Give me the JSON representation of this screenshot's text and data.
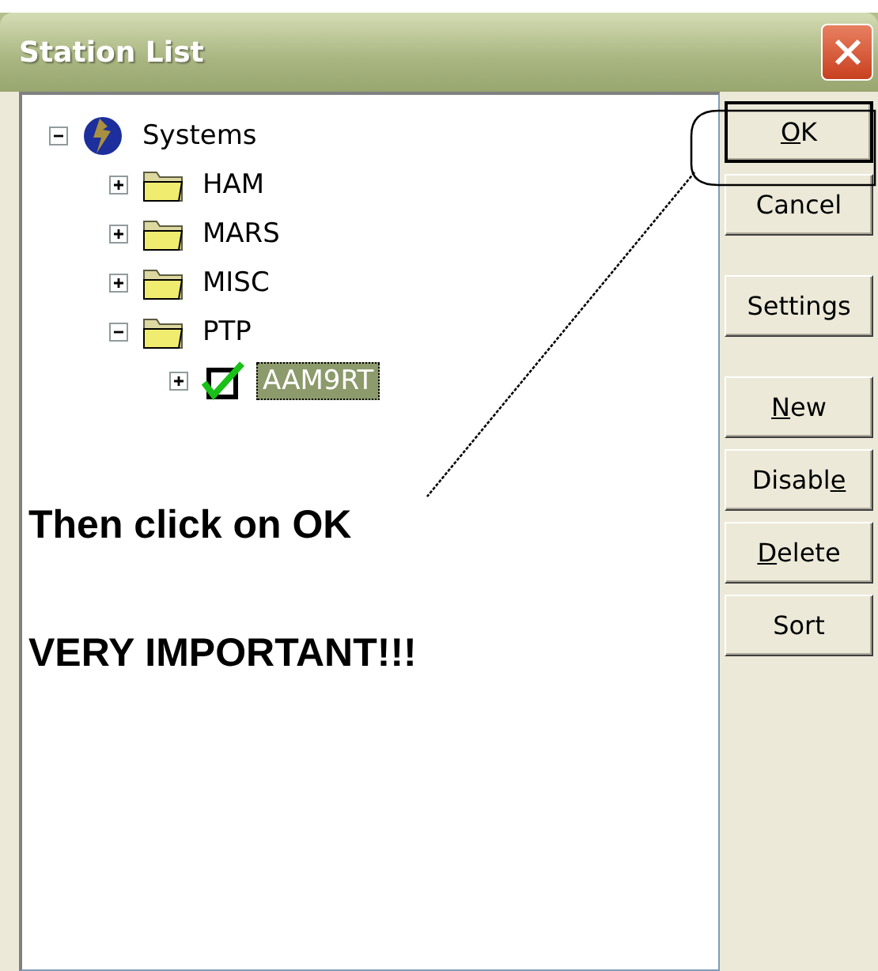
{
  "window": {
    "title": "Station List"
  },
  "tree": [
    {
      "label": "Systems",
      "kind": "globe",
      "expanded": true,
      "children": [
        {
          "label": "HAM",
          "kind": "folder",
          "expanded": false
        },
        {
          "label": "MARS",
          "kind": "folder",
          "expanded": false
        },
        {
          "label": "MISC",
          "kind": "folder",
          "expanded": false
        },
        {
          "label": "PTP",
          "kind": "folder",
          "expanded": true,
          "children": [
            {
              "label": "AAM9RT",
              "kind": "station",
              "expanded": false,
              "checked": true,
              "selected": true
            }
          ]
        }
      ]
    }
  ],
  "annotation": {
    "lines": [
      "Then click on OK",
      "VERY IMPORTANT!!!"
    ]
  },
  "button_groups": [
    [
      {
        "label": [
          {
            "text": "O",
            "underlined": true
          },
          {
            "text": "K",
            "underlined": false
          }
        ],
        "default": true
      },
      {
        "label": [
          {
            "text": "Cancel",
            "underlined": false
          }
        ],
        "default": false
      }
    ],
    [
      {
        "label": [
          {
            "text": "Settings",
            "underlined": false
          }
        ],
        "default": false
      }
    ],
    [
      {
        "label": [
          {
            "text": "N",
            "underlined": true
          },
          {
            "text": "ew",
            "underlined": false
          }
        ],
        "default": false
      },
      {
        "label": [
          {
            "text": "Disabl",
            "underlined": false
          },
          {
            "text": "e",
            "underlined": true
          }
        ],
        "default": false
      },
      {
        "label": [
          {
            "text": "D",
            "underlined": true
          },
          {
            "text": "elete",
            "underlined": false
          }
        ],
        "default": false
      },
      {
        "label": [
          {
            "text": "Sort",
            "underlined": false
          }
        ],
        "default": false
      }
    ]
  ]
}
